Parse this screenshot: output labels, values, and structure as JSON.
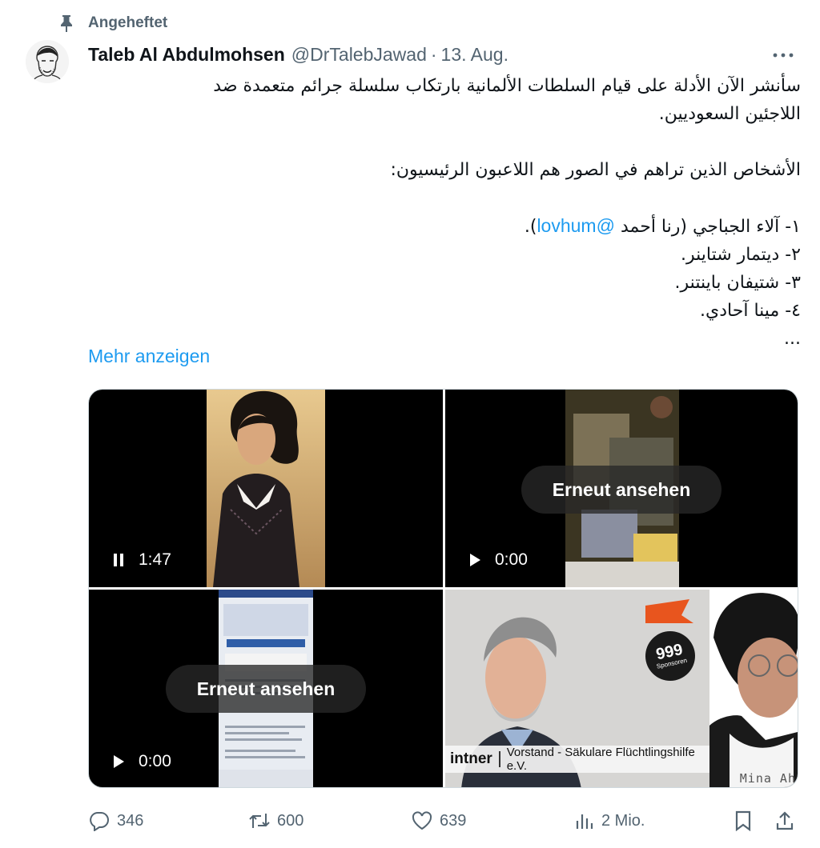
{
  "pinned": {
    "label": "Angeheftet",
    "icon": "pin-icon"
  },
  "author": {
    "name": "Taleb Al Abdulmohsen",
    "handle": "@DrTalebJawad",
    "separator": "·",
    "date": "13. Aug."
  },
  "tweet": {
    "lines": [
      "سأنشر الآن الأدلة على قيام السلطات الألمانية بارتكاب سلسلة جرائم متعمدة ضد",
      "اللاجئين السعوديين.",
      "",
      "الأشخاص الذين تراهم في الصور هم اللاعبون الرئيسيون:",
      "",
      {
        "before": "١- آلاء الجباجي (رنا أحمد ",
        "mention": "@lovhum",
        "after": ")."
      },
      "٢- ديتمار شتاينر.",
      "٣- شتيفان باينتنر.",
      "٤- مينا آحادي.",
      "..."
    ],
    "show_more": "Mehr anzeigen"
  },
  "media": {
    "video1": {
      "time": "1:47",
      "control": "pause"
    },
    "video2": {
      "replay": "Erneut ansehen",
      "time": "0:00",
      "control": "play"
    },
    "video3": {
      "replay": "Erneut ansehen",
      "time": "0:00",
      "control": "play"
    },
    "image4": {
      "caption_name": "intner",
      "caption_text": "Vorstand - Säkulare Flüchtlingshilfe e.V.",
      "side_label": "Mina Ah",
      "badge_num": "999",
      "badge_sub": "Sponsoren"
    }
  },
  "actions": {
    "replies": "346",
    "reposts": "600",
    "likes": "639",
    "views": "2 Mio."
  },
  "colors": {
    "accent": "#1d9bf0",
    "secondary_text": "#536471",
    "primary_text": "#0f1419"
  }
}
